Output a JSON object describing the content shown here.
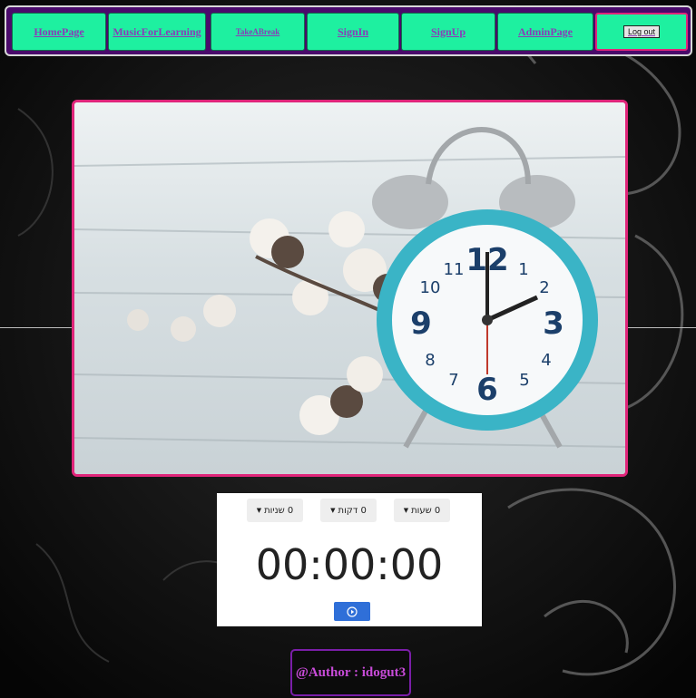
{
  "nav": {
    "items": [
      {
        "label": "HomePage"
      },
      {
        "label": "MusicForLearning"
      },
      {
        "label": "TakeABreak"
      },
      {
        "label": "SignIn"
      },
      {
        "label": "SignUp"
      },
      {
        "label": "AdminPage"
      }
    ],
    "logout_label": "Log out"
  },
  "timer": {
    "hours_label": "0 שעות",
    "minutes_label": "0 דקות",
    "seconds_label": "0 שניות",
    "display": "00:00:00"
  },
  "footer": {
    "author": "@Author : idogut3"
  },
  "colors": {
    "nav_bg": "#4a0a6b",
    "nav_button": "#1ef0a0",
    "accent_pink": "#e0257a",
    "play_blue": "#2f6fd8",
    "footer_text": "#c84bd8"
  }
}
